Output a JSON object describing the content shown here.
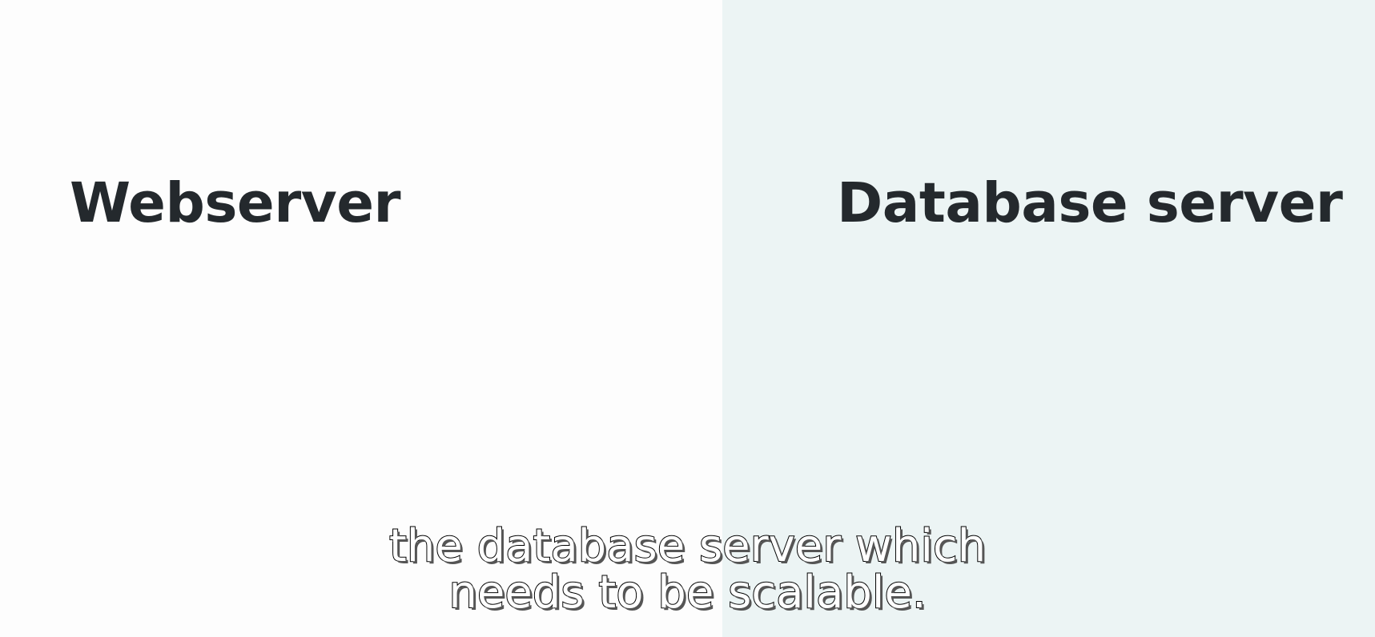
{
  "colors": {
    "left_background": "#fdfdfd",
    "right_background": "#ecf4f4",
    "label_text": "#24292d",
    "subtitle_fill": "#ffffff",
    "subtitle_outline": "#000000"
  },
  "panels": {
    "left": {
      "label": "Webserver"
    },
    "right": {
      "label": "Database server"
    }
  },
  "subtitle": {
    "line1": "the database server which",
    "line2": "needs to be scalable."
  }
}
